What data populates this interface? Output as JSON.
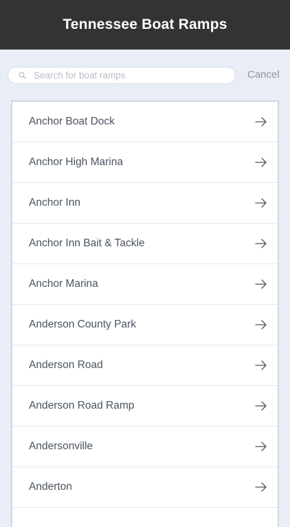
{
  "header": {
    "title": "Tennessee Boat Ramps"
  },
  "search": {
    "placeholder": "Search for boat ramps",
    "value": "",
    "cancel_label": "Cancel",
    "icon": "search-icon"
  },
  "list": {
    "items": [
      {
        "label": "Anchor Boat Dock",
        "icon": "arrow-right-icon"
      },
      {
        "label": "Anchor High Marina",
        "icon": "arrow-right-icon"
      },
      {
        "label": "Anchor Inn",
        "icon": "arrow-right-icon"
      },
      {
        "label": "Anchor Inn Bait & Tackle",
        "icon": "arrow-right-icon"
      },
      {
        "label": "Anchor Marina",
        "icon": "arrow-right-icon"
      },
      {
        "label": "Anderson County Park",
        "icon": "arrow-right-icon"
      },
      {
        "label": "Anderson Road",
        "icon": "arrow-right-icon"
      },
      {
        "label": "Anderson Road Ramp",
        "icon": "arrow-right-icon"
      },
      {
        "label": "Andersonville",
        "icon": "arrow-right-icon"
      },
      {
        "label": "Anderton",
        "icon": "arrow-right-icon"
      }
    ]
  },
  "colors": {
    "header_background": "#333333",
    "page_background": "#e8edf6",
    "list_text": "#4a5360",
    "cancel_text": "#8f95a0"
  }
}
